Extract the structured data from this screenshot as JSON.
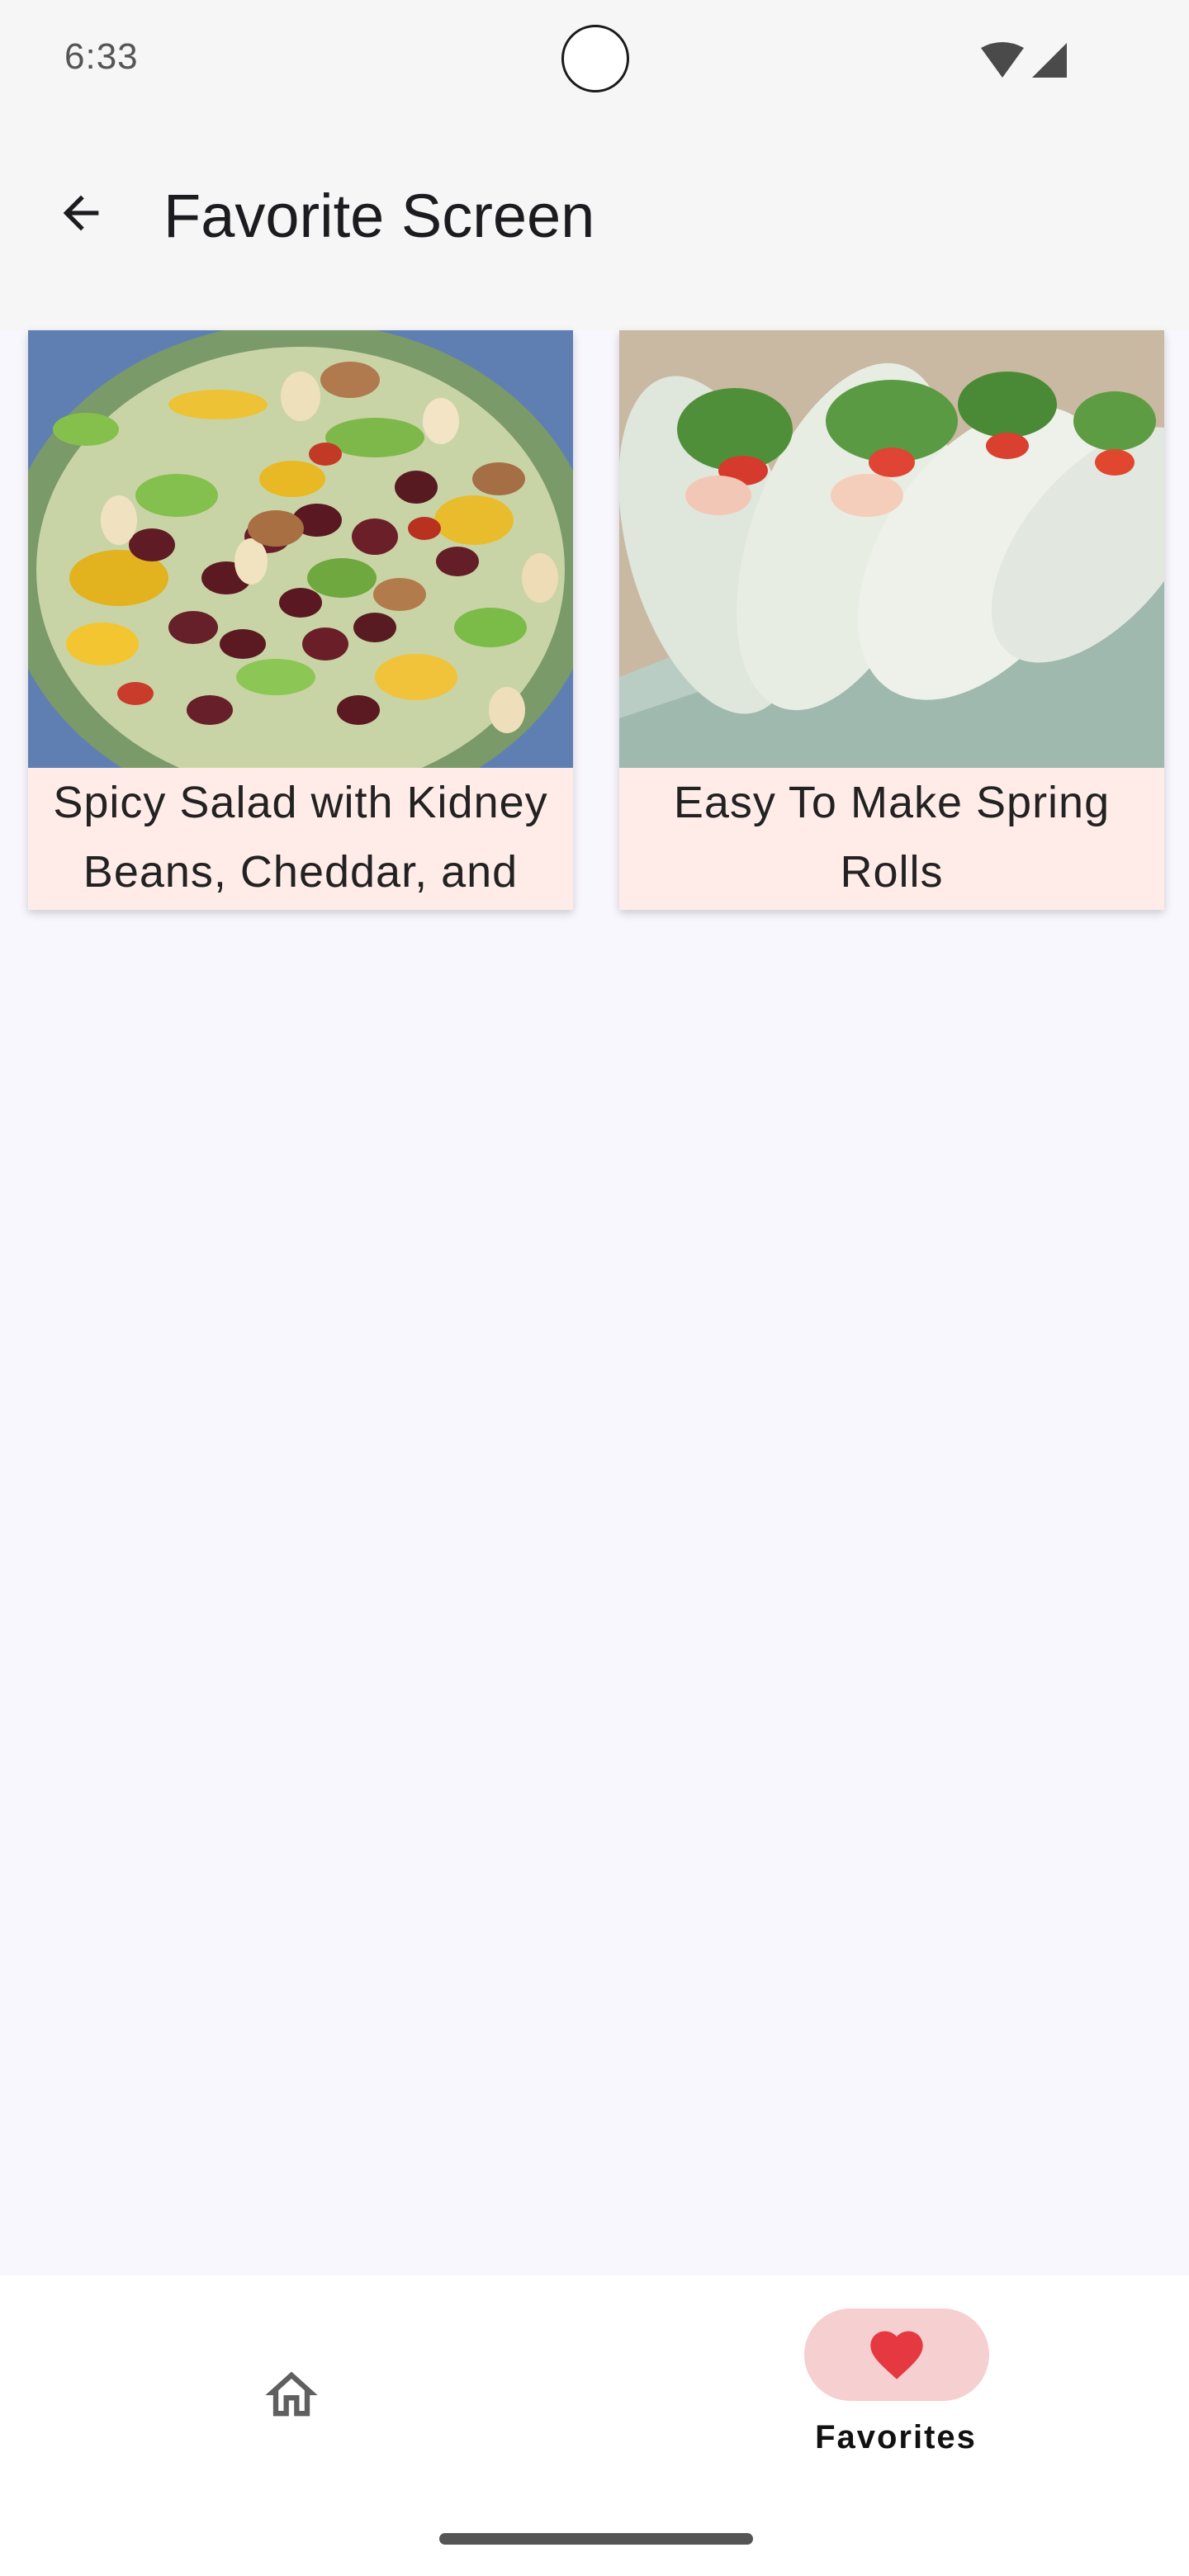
{
  "status_bar": {
    "time": "6:33"
  },
  "header": {
    "title": "Favorite Screen",
    "back_icon": "arrow-back-icon"
  },
  "favorites": [
    {
      "title": "Spicy Salad with Kidney Beans, Cheddar, and"
    },
    {
      "title": "Easy To Make Spring Rolls"
    }
  ],
  "bottom_nav": {
    "home_icon": "home-icon",
    "favorites_icon": "heart-icon",
    "favorites_label": "Favorites",
    "selected": "Favorites"
  },
  "colors": {
    "accent": "#e53840",
    "pill": "#f6cfd0",
    "card": "#ffece8",
    "background": "#f8f7fd"
  }
}
